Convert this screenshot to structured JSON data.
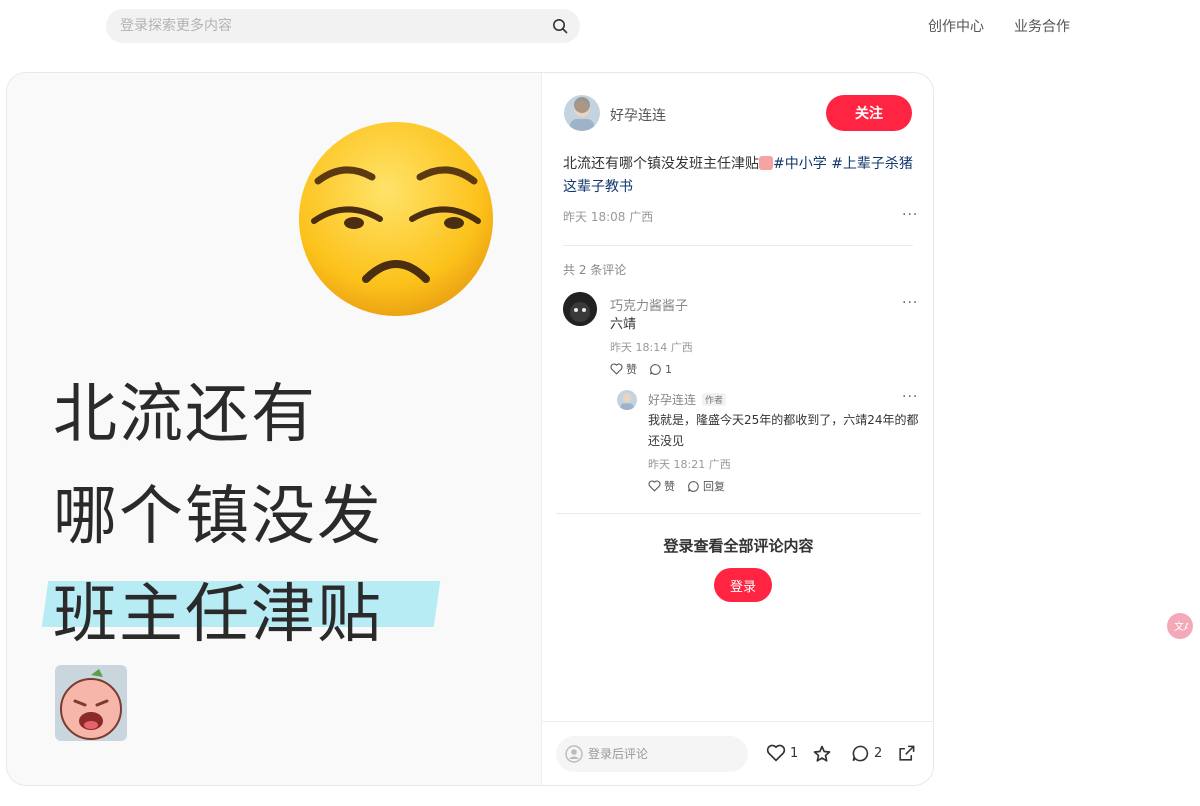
{
  "header": {
    "search_placeholder": "登录探索更多内容",
    "links": [
      "创作中心",
      "业务合作"
    ]
  },
  "poster": {
    "lines": [
      "北流还有",
      "哪个镇没发",
      "班主任津贴"
    ],
    "highlight_color": "#b8ecf5"
  },
  "note": {
    "author": "好孕连连",
    "follow_label": "关注",
    "text_plain": "北流还有哪个镇没发班主任津贴",
    "tags": [
      "#中小学",
      "#上辈子杀猪这辈子教书"
    ],
    "meta": "昨天 18:08 广西",
    "more": "···"
  },
  "comments": {
    "count_label": "共 2 条评论",
    "items": [
      {
        "user": "巧克力酱酱子",
        "text": "六靖",
        "meta": "昨天 18:14 广西",
        "like_label": "赞",
        "reply_count": "1",
        "replies": [
          {
            "user": "好孕连连",
            "badge": "作者",
            "text": "我就是，隆盛今天25年的都收到了，六靖24年的都还没见",
            "meta": "昨天 18:21 广西",
            "like_label": "赞",
            "reply_label": "回复"
          }
        ]
      }
    ]
  },
  "login": {
    "title": "登录查看全部评论内容",
    "button": "登录"
  },
  "bottom_bar": {
    "comment_placeholder": "登录后评论",
    "likes": "1",
    "comments": "2"
  },
  "colors": {
    "accent": "#ff2442",
    "tag": "#13386c"
  }
}
